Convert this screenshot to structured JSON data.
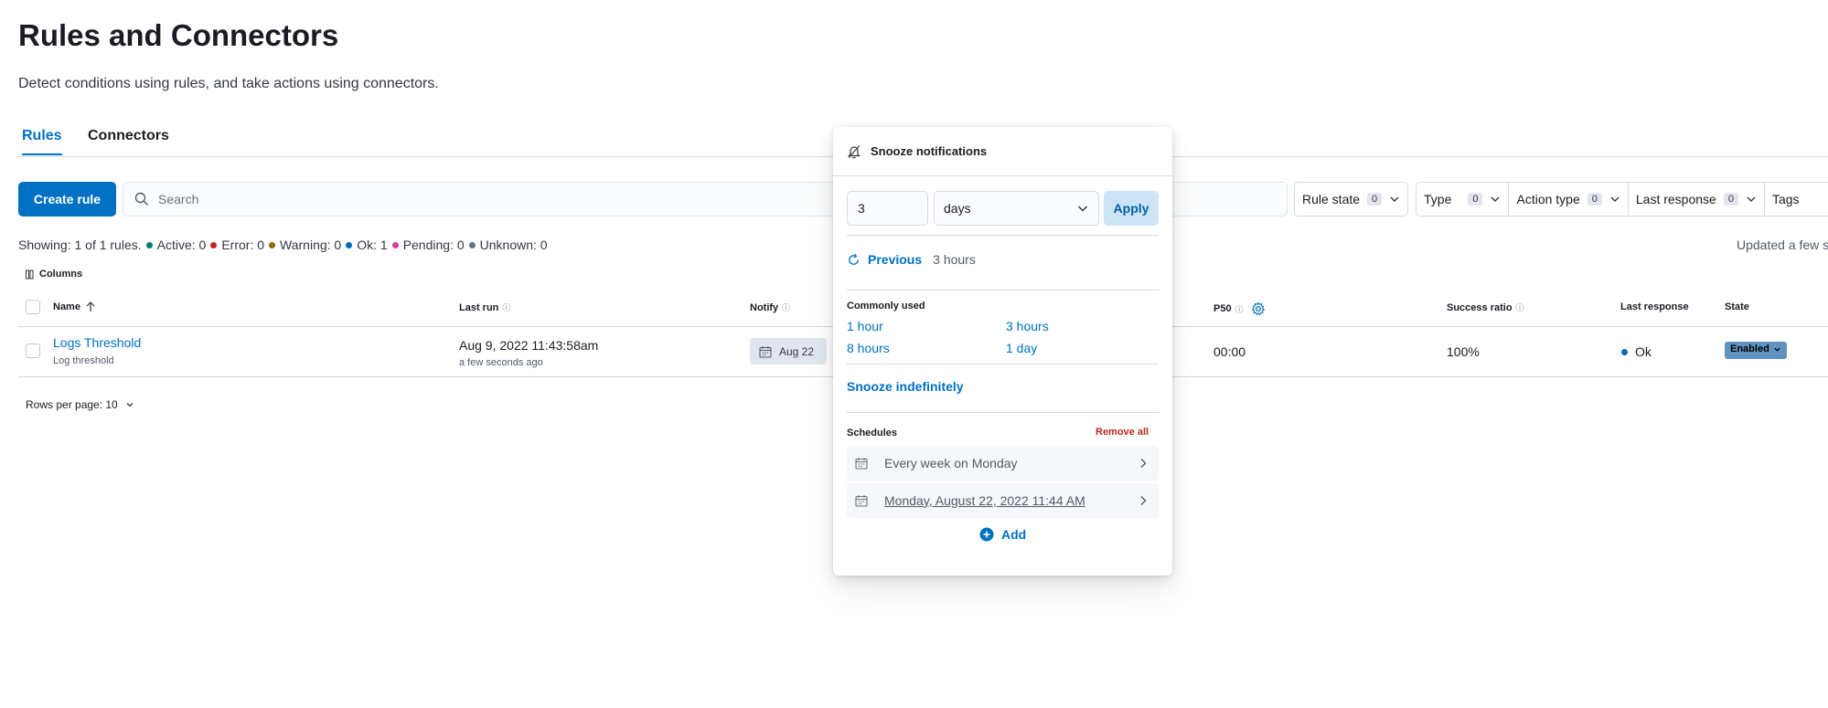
{
  "page": {
    "title": "Rules and Connectors",
    "subtitle": "Detect conditions using rules, and take actions using connectors."
  },
  "tabs": [
    {
      "label": "Rules",
      "active": true
    },
    {
      "label": "Connectors",
      "active": false
    }
  ],
  "toolbar": {
    "create_label": "Create rule",
    "search_placeholder": "Search",
    "filters": [
      {
        "label": "Rule state",
        "count": "0"
      },
      {
        "label": "Type",
        "count": "0"
      },
      {
        "label": "Action type",
        "count": "0"
      },
      {
        "label": "Last response",
        "count": "0"
      },
      {
        "label": "Tags"
      }
    ]
  },
  "summary": {
    "showing": "Showing: 1 of 1 rules.",
    "active": "Active: 0",
    "error": "Error: 0",
    "warning": "Warning: 0",
    "ok": "Ok: 1",
    "pending": "Pending: 0",
    "unknown": "Unknown: 0",
    "updated": "Updated a few s",
    "colors": {
      "active": "#017d73",
      "error": "#bd271e",
      "warning": "#8c6b00",
      "ok": "#006bb8",
      "pending": "#d6409f",
      "unknown": "#69707d"
    }
  },
  "table": {
    "columns_label": "Columns",
    "headers": {
      "name": "Name",
      "last_run": "Last run",
      "notify": "Notify",
      "p50": "P50",
      "success_ratio": "Success ratio",
      "last_response": "Last response",
      "state": "State"
    },
    "rows": [
      {
        "name": "Logs Threshold",
        "type": "Log threshold",
        "last_run": "Aug 9, 2022 11:43:58am",
        "last_run_relative": "a few seconds ago",
        "notify": "Aug 22",
        "p50": "00:00",
        "success_ratio": "100%",
        "last_response": "Ok",
        "state": "Enabled"
      }
    ],
    "rows_per_page": "Rows per page: 10"
  },
  "snooze": {
    "title": "Snooze notifications",
    "amount": "3",
    "unit": "days",
    "apply_label": "Apply",
    "previous_label": "Previous",
    "previous_value": "3 hours",
    "commonly_used_title": "Commonly used",
    "commonly_used": [
      "1 hour",
      "3 hours",
      "8 hours",
      "1 day"
    ],
    "indefinitely_label": "Snooze indefinitely",
    "schedules_title": "Schedules",
    "remove_all_label": "Remove all",
    "schedules": [
      "Every week on Monday",
      "Monday, August 22, 2022 11:44 AM"
    ],
    "add_label": "Add"
  }
}
